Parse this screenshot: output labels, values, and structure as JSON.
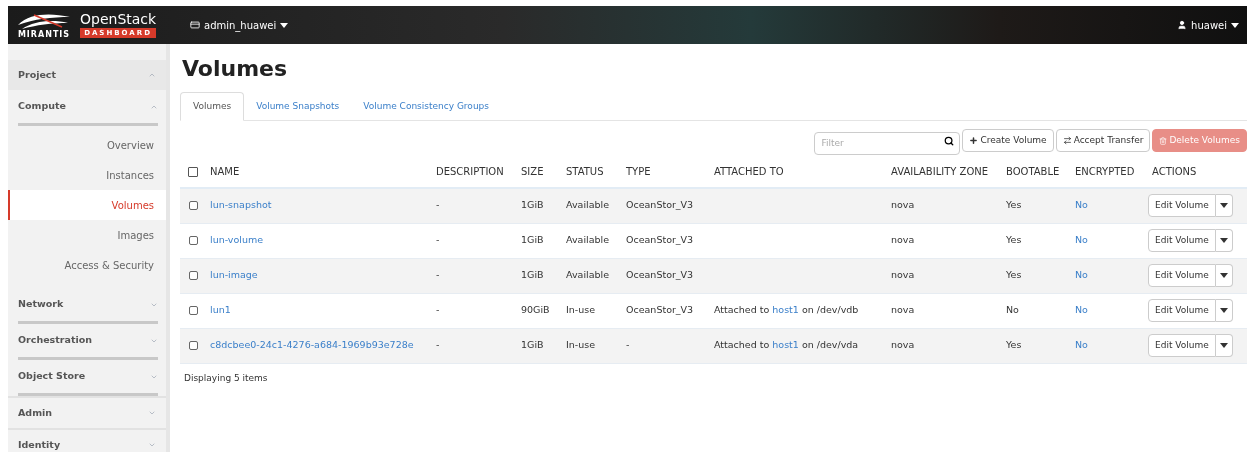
{
  "header": {
    "logo_top": "OpenStack",
    "logo_badge": "DASHBOARD",
    "logo_brand": "MIRANTIS",
    "project": "admin_huawei",
    "user": "huawei"
  },
  "sidebar": [
    {
      "label": "Project",
      "expanded": true,
      "children": [
        {
          "label": "Compute",
          "expanded": true,
          "children": [
            {
              "label": "Overview",
              "selected": false
            },
            {
              "label": "Instances",
              "selected": false
            },
            {
              "label": "Volumes",
              "selected": true
            },
            {
              "label": "Images",
              "selected": false
            },
            {
              "label": "Access & Security",
              "selected": false
            }
          ]
        },
        {
          "label": "Network",
          "expanded": false
        },
        {
          "label": "Orchestration",
          "expanded": false
        },
        {
          "label": "Object Store",
          "expanded": false
        }
      ]
    },
    {
      "label": "Admin",
      "expanded": false
    },
    {
      "label": "Identity",
      "expanded": false
    }
  ],
  "title": "Volumes",
  "tabs": [
    {
      "label": "Volumes",
      "selected": true
    },
    {
      "label": "Volume Snapshots",
      "selected": false
    },
    {
      "label": "Volume Consistency Groups",
      "selected": false
    }
  ],
  "filter": {
    "placeholder": "Filter"
  },
  "actions": [
    {
      "kind": "plus",
      "label": "Create Volume",
      "disabled": false
    },
    {
      "kind": "transfer",
      "label": "Accept Transfer",
      "disabled": false
    },
    {
      "kind": "trash",
      "label": "Delete Volumes",
      "disabled": true
    }
  ],
  "table": {
    "all_checked": false,
    "columns": [
      "NAME",
      "DESCRIPTION",
      "SIZE",
      "STATUS",
      "TYPE",
      "ATTACHED TO",
      "AVAILABILITY ZONE",
      "BOOTABLE",
      "ENCRYPTED",
      "ACTIONS"
    ],
    "rows": [
      {
        "checked": false,
        "name": "lun-snapshot",
        "description": "-",
        "size": "1GiB",
        "status": "Available",
        "type": "OceanStor_V3",
        "zone": "nova",
        "bootable": "Yes",
        "encrypted": "No",
        "action": "Edit Volume"
      },
      {
        "checked": false,
        "name": "lun-volume",
        "description": "-",
        "size": "1GiB",
        "status": "Available",
        "type": "OceanStor_V3",
        "zone": "nova",
        "bootable": "Yes",
        "encrypted": "No",
        "action": "Edit Volume"
      },
      {
        "checked": false,
        "name": "lun-image",
        "description": "-",
        "size": "1GiB",
        "status": "Available",
        "type": "OceanStor_V3",
        "zone": "nova",
        "bootable": "Yes",
        "encrypted": "No",
        "action": "Edit Volume"
      },
      {
        "checked": false,
        "name": "lun1",
        "description": "-",
        "size": "90GiB",
        "status": "In-use",
        "type": "OceanStor_V3",
        "attached": {
          "before": "Attached to",
          "link": "host1",
          "after": "on /dev/vdb"
        },
        "zone": "nova",
        "bootable": "No",
        "encrypted": "No",
        "action": "Edit Volume"
      },
      {
        "checked": false,
        "name": "c8dcbee0-24c1-4276-a684-1969b93e728e",
        "description": "-",
        "size": "1GiB",
        "status": "In-use",
        "type": "-",
        "attached": {
          "before": "Attached to",
          "link": "host1",
          "after": "on /dev/vda"
        },
        "zone": "nova",
        "bootable": "Yes",
        "encrypted": "No",
        "action": "Edit Volume"
      }
    ],
    "footer": "Displaying 5 items"
  }
}
